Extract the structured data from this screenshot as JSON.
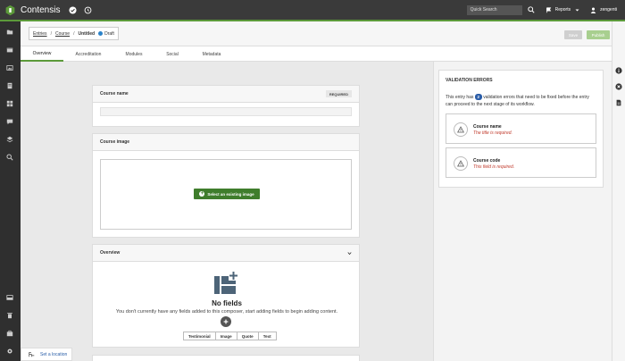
{
  "app": {
    "title": "Contensis"
  },
  "topbar": {
    "search_placeholder": "Quick Search",
    "reports_label": "Reports",
    "user_label": "zengenti"
  },
  "breadcrumb": {
    "items": [
      "Entries",
      "Course",
      "Untitled"
    ],
    "status": "Draft"
  },
  "actions": {
    "save": "Save",
    "publish": "Publish"
  },
  "tabs": [
    "Overview",
    "Accreditation",
    "Modules",
    "Social",
    "Metadata"
  ],
  "cards": {
    "course_name": {
      "label": "Course name",
      "required": "REQUIRED"
    },
    "course_image": {
      "label": "Course image",
      "button": "Select an existing image"
    },
    "overview": {
      "label": "Overview",
      "empty_title": "No fields",
      "empty_desc": "You don't currently have any fields added to this composer, start adding fields to begin adding content.",
      "field_types": [
        "Testimonial",
        "Image",
        "Quote",
        "Text"
      ]
    }
  },
  "validation": {
    "title": "VALIDATION ERRORS",
    "desc_before": "This entry has",
    "count": "2",
    "desc_after": "validation errors that need to be fixed before the entry can proceed to the next stage of its workflow.",
    "errors": [
      {
        "field": "Course name",
        "message": "The title is required."
      },
      {
        "field": "Course code",
        "message": "This field is required."
      }
    ]
  },
  "location": {
    "label": "Set a location"
  },
  "colors": {
    "accent": "#5c9a3a",
    "draft": "#2b82c9",
    "error": "#c0392b",
    "badge": "#2b5da8"
  },
  "icons": [
    "contensis-logo-icon",
    "check-circle-icon",
    "history-icon",
    "search-icon",
    "flag-icon",
    "user-icon",
    "info-icon",
    "close-circle-icon",
    "document-icon",
    "warning-icon",
    "plus-icon",
    "chevron-down-icon",
    "location-icon"
  ]
}
